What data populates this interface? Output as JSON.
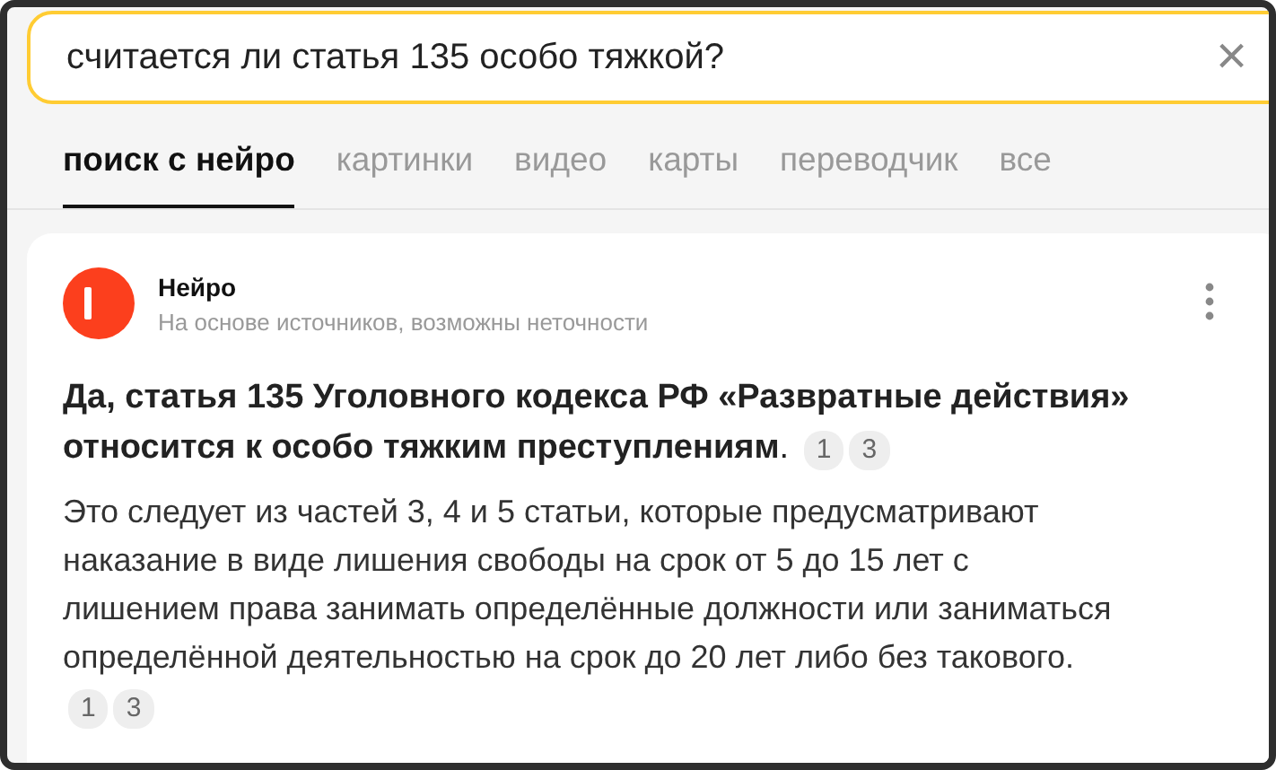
{
  "search": {
    "value": "считается ли статья 135 особо тяжкой?",
    "clear": "×"
  },
  "tabs": [
    {
      "label": "поиск с нейро",
      "selected": true
    },
    {
      "label": "картинки",
      "selected": false
    },
    {
      "label": "видео",
      "selected": false
    },
    {
      "label": "карты",
      "selected": false
    },
    {
      "label": "переводчик",
      "selected": false
    },
    {
      "label": "все",
      "selected": false
    }
  ],
  "answer": {
    "source": "Нейро",
    "subtitle": "На основе источников, возможны неточности",
    "headline": "**Да, статья 135 Уголовного кодекса РФ «Развратные действия» относится к особо тяжким преступлениям**.",
    "headline_citations": [
      "1",
      "3"
    ],
    "body": "Это следует из частей 3, 4 и 5 статьи, которые предусматривают наказание в виде лишения свободы на срок от 5 до 15 лет с лишением права занимать определённые должности или заниматься определённой деятельностью на срок до 20 лет либо без такового.",
    "body_citations": [
      "1",
      "3"
    ]
  }
}
